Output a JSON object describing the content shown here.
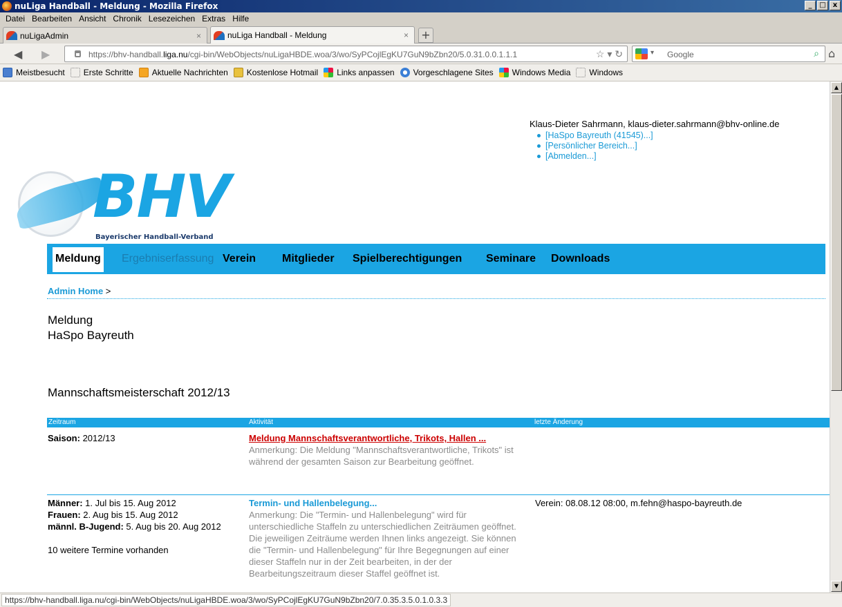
{
  "window": {
    "title": "nuLiga Handball - Meldung - Mozilla Firefox",
    "controls": [
      "_",
      "□",
      "x"
    ]
  },
  "menu": [
    "Datei",
    "Bearbeiten",
    "Ansicht",
    "Chronik",
    "Lesezeichen",
    "Extras",
    "Hilfe"
  ],
  "tabs": [
    {
      "label": "nuLigaAdmin",
      "active": false
    },
    {
      "label": "nuLiga Handball - Meldung",
      "active": true
    }
  ],
  "nav": {
    "url_prefix": "https://bhv-handball.",
    "url_domain": "liga.nu",
    "url_suffix": "/cgi-bin/WebObjects/nuLigaHBDE.woa/3/wo/SyPCojlEgKU7GuN9bZbn20/5.0.31.0.0.1.1.1",
    "search_placeholder": "Google"
  },
  "bookmarks": [
    {
      "label": "Meistbesucht",
      "icon": "blue"
    },
    {
      "label": "Erste Schritte",
      "icon": "blank"
    },
    {
      "label": "Aktuelle Nachrichten",
      "icon": "rss"
    },
    {
      "label": "Kostenlose Hotmail",
      "icon": "mail"
    },
    {
      "label": "Links anpassen",
      "icon": "win"
    },
    {
      "label": "Vorgeschlagene Sites",
      "icon": "ie"
    },
    {
      "label": "Windows Media",
      "icon": "win"
    },
    {
      "label": "Windows",
      "icon": "blank"
    }
  ],
  "user": {
    "name": "Klaus-Dieter Sahrmann, klaus-dieter.sahrmann@bhv-online.de",
    "links": [
      "[HaSpo Bayreuth (41545)...]",
      "[Persönlicher Bereich...]",
      "[Abmelden...]"
    ]
  },
  "logo": {
    "text": "BHV",
    "subtitle": "Bayerischer Handball-Verband"
  },
  "mainnav": [
    {
      "label": "Meldung",
      "state": "active"
    },
    {
      "label": "Ergebniserfassung",
      "state": "muted"
    },
    {
      "label": "Verein",
      "state": "normal"
    },
    {
      "label": "Mitglieder",
      "state": "normal"
    },
    {
      "label": "Spielberechtigungen",
      "state": "normal"
    },
    {
      "label": "Seminare",
      "state": "normal"
    },
    {
      "label": "Downloads",
      "state": "normal"
    }
  ],
  "breadcrumb": {
    "home": "Admin Home",
    "sep": ">"
  },
  "heading": {
    "line1": "Meldung",
    "line2": "HaSpo Bayreuth"
  },
  "section_title": "Mannschaftsmeisterschaft 2012/13",
  "table": {
    "headers": [
      "Zeitraum",
      "Aktivität",
      "letzte Änderung"
    ],
    "row1": {
      "zeitraum_label": "Saison:",
      "zeitraum_value": " 2012/13",
      "activity_link": "Meldung Mannschaftsverantwortliche, Trikots, Hallen ...",
      "activity_note": "Anmerkung: Die Meldung \"Mannschaftsverantwortliche, Trikots\" ist während der gesamten Saison zur Bearbeitung geöffnet.",
      "last_change": ""
    },
    "row2": {
      "periods": [
        {
          "label": "Männer:",
          "value": " 1. Jul bis 15. Aug 2012"
        },
        {
          "label": "Frauen:",
          "value": " 2. Aug bis 15. Aug 2012"
        },
        {
          "label": "männl. B-Jugend:",
          "value": " 5. Aug bis 20. Aug 2012"
        }
      ],
      "more": "10 weitere Termine vorhanden",
      "activity_link": "Termin- und Hallenbelegung...",
      "activity_note": "Anmerkung: Die \"Termin- und Hallenbelegung\" wird für unterschiedliche Staffeln zu unterschiedlichen Zeiträumen geöffnet. Die jeweiligen Zeiträume werden Ihnen links angezeigt. Sie können die \"Termin- und Hallenbelegung\" für Ihre Begegnungen auf einer dieser Staffeln nur in der Zeit bearbeiten, in der der Bearbeitungszeitraum dieser Staffel geöffnet ist.",
      "last_change": "Verein: 08.08.12 08:00, m.fehn@haspo-bayreuth.de"
    }
  },
  "status": "https://bhv-handball.liga.nu/cgi-bin/WebObjects/nuLigaHBDE.woa/3/wo/SyPCojlEgKU7GuN9bZbn20/7.0.35.3.5.0.1.0.3.3"
}
